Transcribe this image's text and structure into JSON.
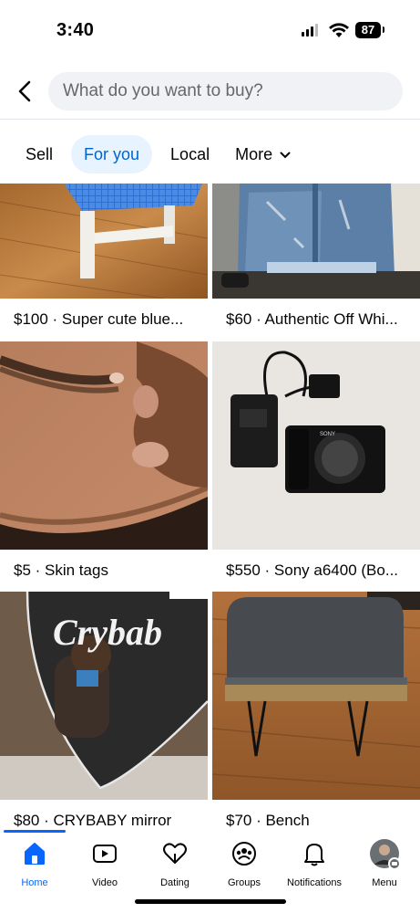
{
  "status": {
    "time": "3:40",
    "battery": "87"
  },
  "search": {
    "placeholder": "What do you want to buy?"
  },
  "tabs": [
    {
      "label": "Sell"
    },
    {
      "label": "For you"
    },
    {
      "label": "Local"
    },
    {
      "label": "More"
    }
  ],
  "listings": [
    {
      "caption": "$100 · Super cute blue..."
    },
    {
      "caption": "$60 · Authentic Off Whi..."
    },
    {
      "caption": "$5 · Skin tags"
    },
    {
      "caption": "$550 · Sony a6400 (Bo..."
    },
    {
      "caption": "$80 · CRYBABY mirror"
    },
    {
      "caption": "$70 · Bench"
    }
  ],
  "mirror_text": "Crybab",
  "nav": [
    {
      "label": "Home",
      "icon": "home-icon"
    },
    {
      "label": "Video",
      "icon": "video-icon"
    },
    {
      "label": "Dating",
      "icon": "heart-icon"
    },
    {
      "label": "Groups",
      "icon": "groups-icon"
    },
    {
      "label": "Notifications",
      "icon": "bell-icon"
    },
    {
      "label": "Menu",
      "icon": "avatar-icon"
    }
  ],
  "colors": {
    "accent": "#0866ff",
    "active_tab_bg": "#e7f3ff",
    "search_bg": "#f0f2f5"
  }
}
